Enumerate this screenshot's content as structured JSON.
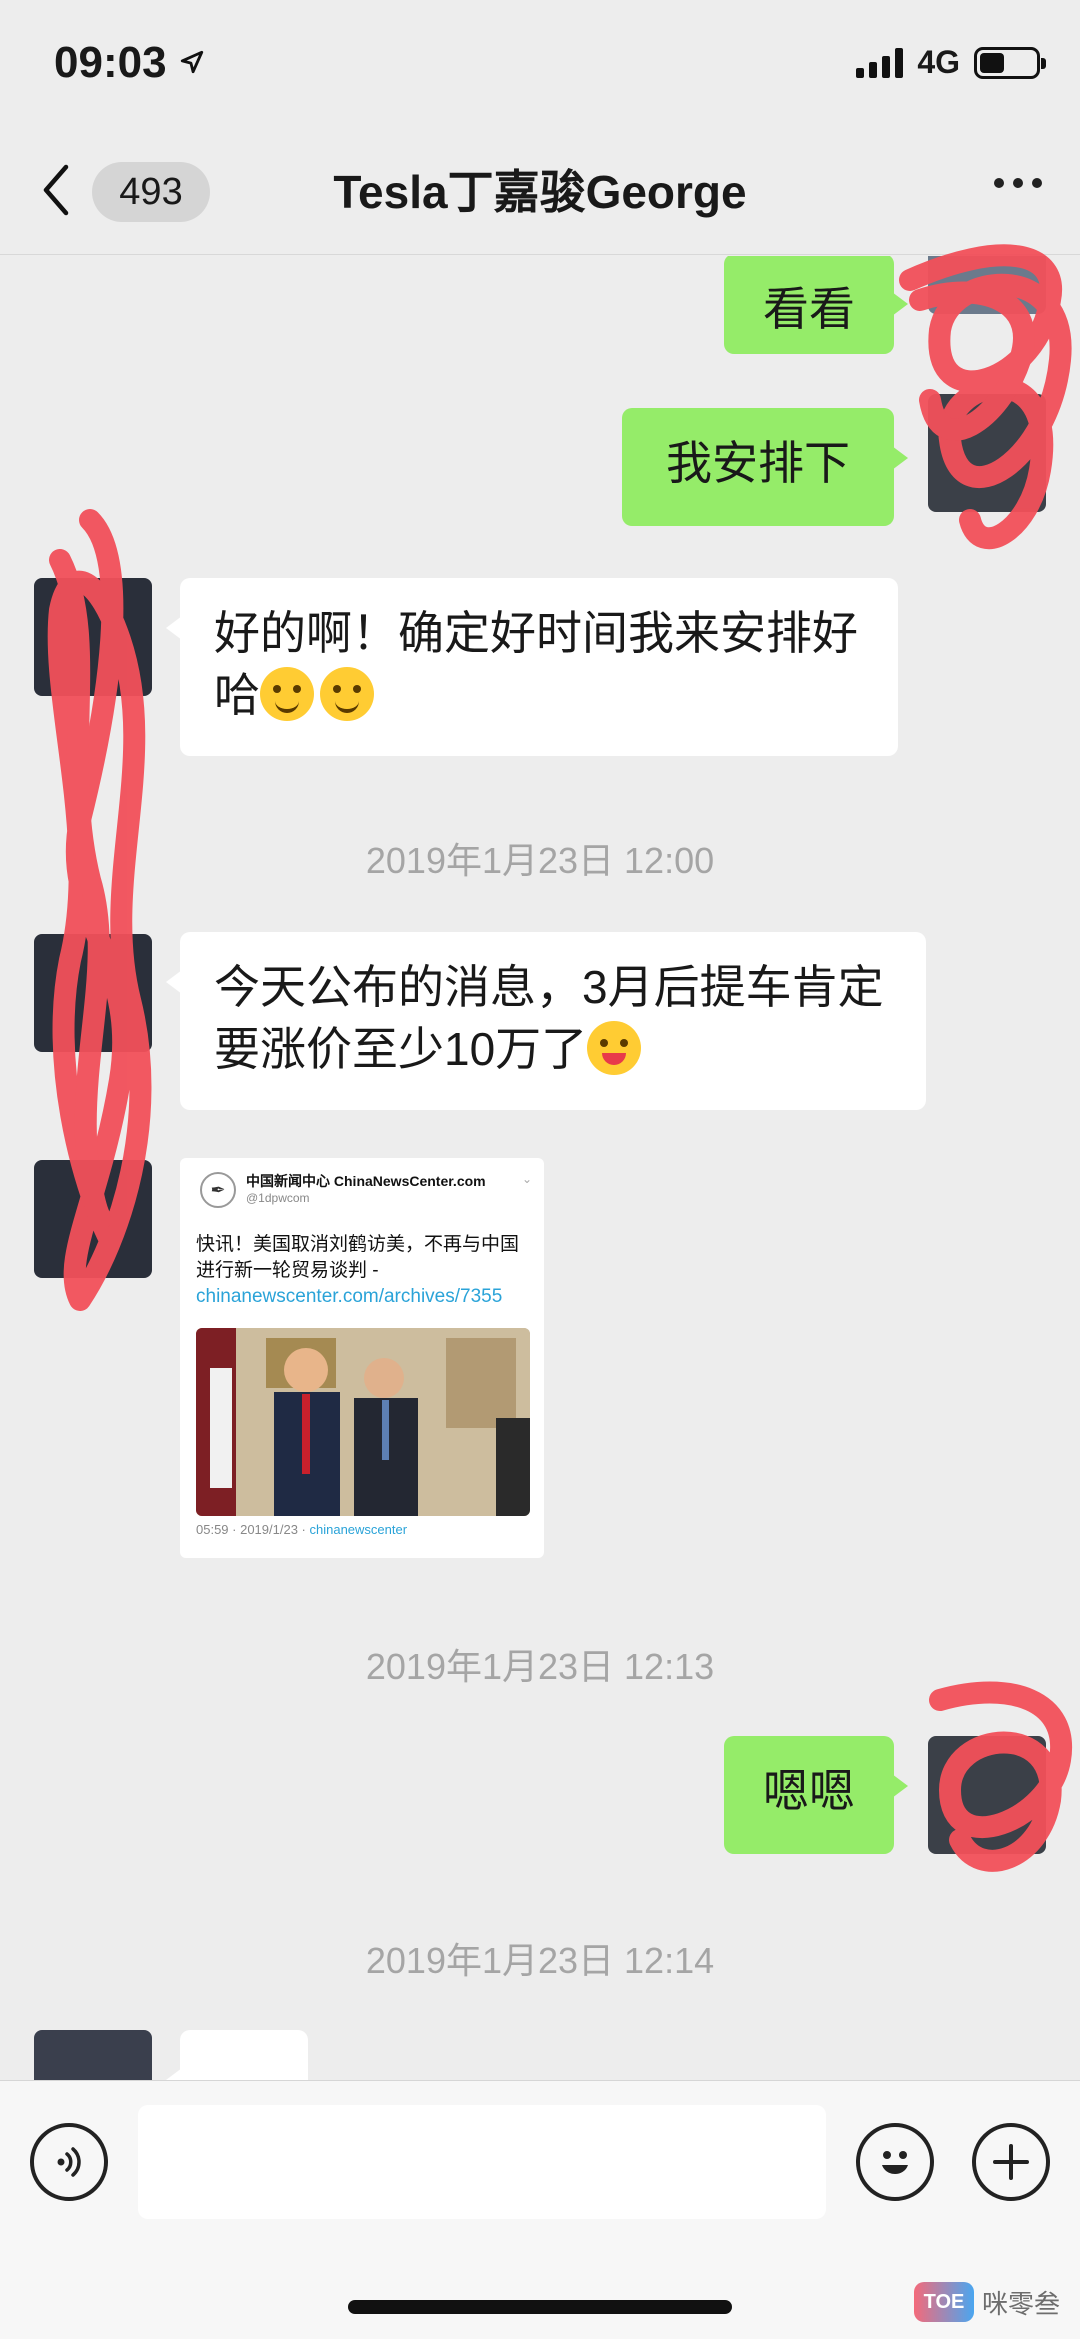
{
  "status_bar": {
    "time": "09:03",
    "network": "4G"
  },
  "header": {
    "back_count": "493",
    "title": "Tesla丁嘉骏George"
  },
  "messages": [
    {
      "side": "me",
      "text": "看看"
    },
    {
      "side": "me",
      "text": "我安排下"
    },
    {
      "side": "other",
      "text": "好的啊！确定好时间我来安排好哈"
    },
    {
      "side": "other",
      "text": "今天公布的消息，3月后提车肯定要涨价至少10万了"
    },
    {
      "side": "me",
      "text": "嗯嗯"
    }
  ],
  "timestamps": [
    "2019年1月23日 12:00",
    "2019年1月23日 12:13",
    "2019年1月23日 12:14"
  ],
  "tweet_card": {
    "account_name": "中国新闻中心 ChinaNewsCenter.com",
    "handle": "@1dpwcom",
    "text": "快讯！美国取消刘鹤访美，不再与中国进行新一轮贸易谈判 - ",
    "link": "chinanewscenter.com/archives/7355",
    "time": "05:59 · 2019/1/23 · ",
    "source": "chinanewscenter"
  },
  "input_bar": {
    "placeholder": ""
  },
  "watermark": {
    "text": "咪零叁"
  },
  "icons": [
    "location-arrow-icon",
    "back-chevron-icon",
    "more-icon",
    "voice-icon",
    "emoji-icon",
    "plus-icon"
  ]
}
